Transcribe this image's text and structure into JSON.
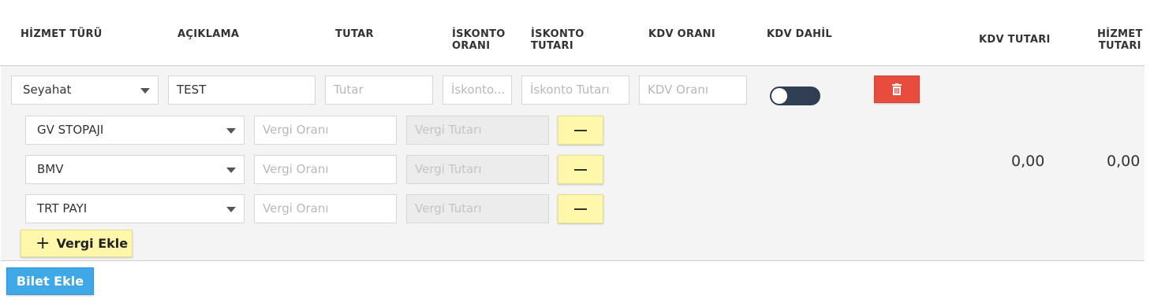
{
  "header": {
    "hizmet_turu": "HİZMET TÜRÜ",
    "aciklama": "AÇIKLAMA",
    "tutar": "TUTAR",
    "iskonto_orani_1": "İSKONTO",
    "iskonto_orani_2": "ORANI",
    "iskonto_tutari_1": "İSKONTO",
    "iskonto_tutari_2": "TUTARI",
    "kdv_orani": "KDV ORANI",
    "kdv_dahil": "KDV DAHİL",
    "kdv_tutari": "KDV TUTARI",
    "hizmet_tutari_1": "HİZMET",
    "hizmet_tutari_2": "TUTARI"
  },
  "row": {
    "service_type": "Seyahat",
    "description": "TEST",
    "amount_placeholder": "Tutar",
    "discount_rate_placeholder": "İskonto...",
    "discount_amount_placeholder": "İskonto Tutarı",
    "vat_rate_placeholder": "KDV Oranı",
    "kdv_dahil_on": false,
    "delete_icon": "trash-icon",
    "kdv_tutari_value": "0,00",
    "hizmet_tutari_value": "0,00"
  },
  "taxes": [
    {
      "type": "GV STOPAJI",
      "rate_placeholder": "Vergi Oranı",
      "amount_placeholder": "Vergi Tutarı"
    },
    {
      "type": "BMV",
      "rate_placeholder": "Vergi Oranı",
      "amount_placeholder": "Vergi Tutarı"
    },
    {
      "type": "TRT PAYI",
      "rate_placeholder": "Vergi Oranı",
      "amount_placeholder": "Vergi Tutarı"
    }
  ],
  "buttons": {
    "add_tax": "Vergi Ekle",
    "add_tax_icon": "plus-icon",
    "add_ticket": "Bilet Ekle",
    "remove_tax_icon": "minus-icon"
  },
  "colors": {
    "delete": "#e74c3c",
    "yellow_button": "#fff7aa",
    "primary": "#3fa9e8",
    "toggle_off": "#2f3e53"
  }
}
